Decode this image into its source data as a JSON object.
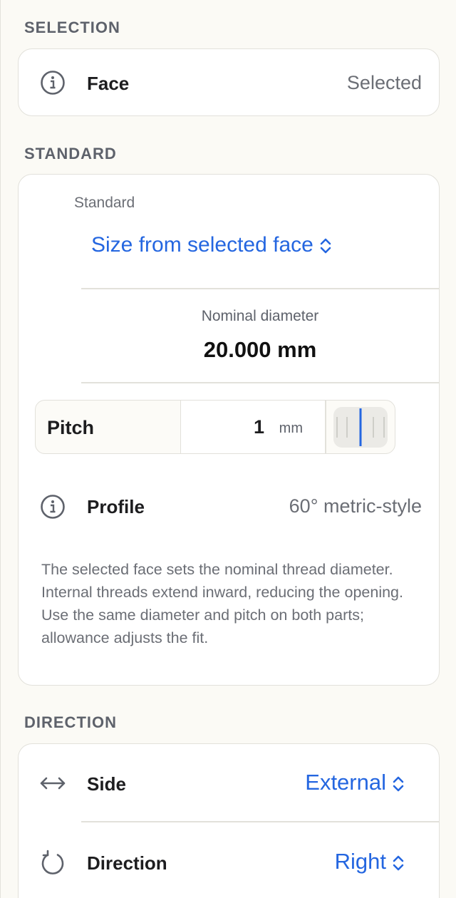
{
  "selection": {
    "section_title": "SELECTION",
    "face": {
      "icon": "info-icon",
      "label": "Face",
      "value": "Selected"
    }
  },
  "standard": {
    "section_title": "STANDARD",
    "standard_label": "Standard",
    "standard_value": "Size from selected face",
    "nominal_label": "Nominal diameter",
    "nominal_value": "20.000 mm",
    "pitch": {
      "label": "Pitch",
      "value": "1",
      "unit": "mm"
    },
    "profile": {
      "icon": "info-icon",
      "label": "Profile",
      "value": "60° metric-style"
    },
    "description": "The selected face sets the nominal thread diameter. Internal threads extend inward, reducing the opening. Use the same diameter and pitch on both parts; allowance adjusts the fit."
  },
  "direction": {
    "section_title": "DIRECTION",
    "side": {
      "icon": "left-right-arrow-icon",
      "label": "Side",
      "value": "External"
    },
    "dir": {
      "icon": "rotate-icon",
      "label": "Direction",
      "value": "Right"
    }
  },
  "colors": {
    "accent": "#2466e0",
    "background": "#fbfaf5",
    "card": "#ffffff",
    "muted": "#6b6e75"
  }
}
